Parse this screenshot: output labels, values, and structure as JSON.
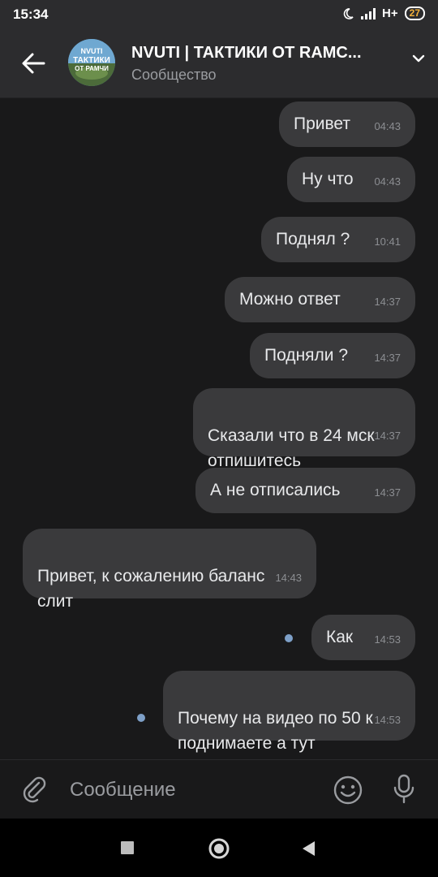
{
  "status_bar": {
    "time": "15:34",
    "network": "H+",
    "battery": "27"
  },
  "header": {
    "title": "NVUTI | ТАКТИКИ ОТ  RAMC...",
    "subtitle": "Сообщество",
    "avatar_text_top": "NVUTI",
    "avatar_text_mid": "ТАКТИКИ",
    "avatar_text_bot": "ОТ РАМЧИ"
  },
  "messages": [
    {
      "text": "Привет",
      "time": "04:43",
      "direction": "out"
    },
    {
      "text": "Ну что",
      "time": "04:43",
      "direction": "out"
    },
    {
      "text": "Поднял ?",
      "time": "10:41",
      "direction": "out"
    },
    {
      "text": "Можно ответ",
      "time": "14:37",
      "direction": "out"
    },
    {
      "text": "Подняли ?",
      "time": "14:37",
      "direction": "out"
    },
    {
      "text": "Сказали что в 24 мск\nотпишитесь",
      "time": "14:37",
      "direction": "out"
    },
    {
      "text": "А не отписались",
      "time": "14:37",
      "direction": "out"
    },
    {
      "text": "Привет, к сожалению баланс\nслит",
      "time": "14:43",
      "direction": "in"
    },
    {
      "text": "Как",
      "time": "14:53",
      "direction": "out",
      "unread": true
    },
    {
      "text": "Почему на видео по 50 к\nподнимаете а тут",
      "time": "14:53",
      "direction": "out",
      "unread": true
    }
  ],
  "composer": {
    "placeholder": "Сообщение"
  },
  "icons": {
    "back": "arrow-left-icon",
    "dropdown": "chevron-down-icon",
    "attach": "paperclip-icon",
    "emoji": "smiley-icon",
    "voice": "microphone-icon",
    "nav_recent": "square-icon",
    "nav_home": "circle-icon",
    "nav_back": "triangle-icon"
  },
  "colors": {
    "background": "#19191a",
    "bubble": "#3a3a3c",
    "header": "#2c2c2e",
    "unread_dot": "#7ea0c8"
  }
}
